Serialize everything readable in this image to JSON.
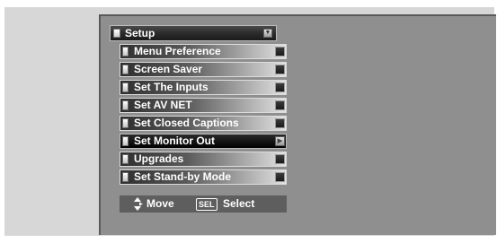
{
  "menu": {
    "title": "Setup",
    "title_icon": "down-triangle-icon",
    "items": [
      {
        "label": "Menu Preference",
        "selected": false
      },
      {
        "label": "Screen Saver",
        "selected": false
      },
      {
        "label": "Set The Inputs",
        "selected": false
      },
      {
        "label": "Set AV NET",
        "selected": false
      },
      {
        "label": "Set Closed Captions",
        "selected": false
      },
      {
        "label": "Set Monitor Out",
        "selected": true
      },
      {
        "label": "Upgrades",
        "selected": false
      },
      {
        "label": "Set Stand-by Mode",
        "selected": false
      }
    ],
    "selected_indicator_icon": "right-triangle-icon"
  },
  "help": {
    "move_icon": "updown-arrows-icon",
    "move_label": "Move",
    "sel_key": "SEL",
    "select_label": "Select"
  },
  "colors": {
    "screen_background": "#d7d7d7",
    "panel_background": "#8f8f8f",
    "selected_item": "#000000",
    "help_bar": "#5e5e5e"
  }
}
